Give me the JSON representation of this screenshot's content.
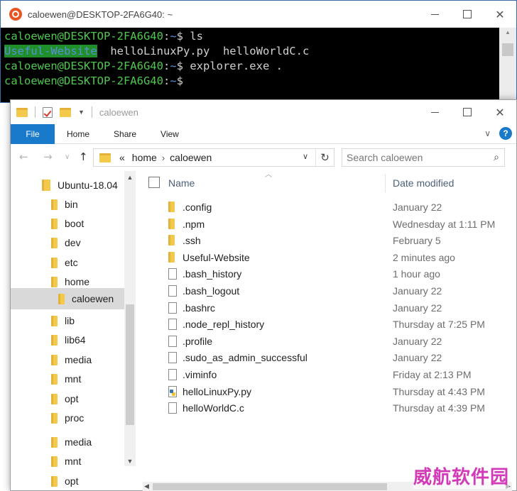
{
  "terminal": {
    "title": "caloewen@DESKTOP-2FA6G40: ~",
    "lines": [
      {
        "user": "caloewen@DESKTOP-2FA6G40",
        "path": "~",
        "cmd": "$ ls"
      },
      {
        "dir": "Useful-Website",
        "files": "  helloLinuxPy.py  helloWorldC.c"
      },
      {
        "user": "caloewen@DESKTOP-2FA6G40",
        "path": "~",
        "cmd": "$ explorer.exe ."
      },
      {
        "user": "caloewen@DESKTOP-2FA6G40",
        "path": "~",
        "cmd": "$"
      }
    ]
  },
  "explorer": {
    "title": "caloewen",
    "ribbon_tabs": [
      "File",
      "Home",
      "Share",
      "View"
    ],
    "help_label": "?",
    "address": {
      "prefix": "«",
      "crumbs": [
        "home",
        "caloewen"
      ]
    },
    "search_placeholder": "Search caloewen",
    "tree": [
      {
        "label": "Ubuntu-18.04",
        "selected": false
      },
      {
        "label": "bin"
      },
      {
        "label": "boot"
      },
      {
        "label": "dev"
      },
      {
        "label": "etc"
      },
      {
        "label": "home"
      },
      {
        "label": "caloewen",
        "selected": true
      },
      {
        "label": "lib"
      },
      {
        "label": "lib64"
      },
      {
        "label": "media"
      },
      {
        "label": "mnt"
      },
      {
        "label": "opt"
      },
      {
        "label": "proc"
      },
      {
        "label": "media"
      },
      {
        "label": "mnt"
      },
      {
        "label": "opt"
      }
    ],
    "columns": {
      "name": "Name",
      "date": "Date modified"
    },
    "files": [
      {
        "name": ".config",
        "date": "January 22",
        "type": "folder"
      },
      {
        "name": ".npm",
        "date": "Wednesday at 1:11 PM",
        "type": "folder"
      },
      {
        "name": ".ssh",
        "date": "February 5",
        "type": "folder"
      },
      {
        "name": "Useful-Website",
        "date": "2 minutes ago",
        "type": "folder"
      },
      {
        "name": ".bash_history",
        "date": "1 hour ago",
        "type": "file"
      },
      {
        "name": ".bash_logout",
        "date": "January 22",
        "type": "file"
      },
      {
        "name": ".bashrc",
        "date": "January 22",
        "type": "file"
      },
      {
        "name": ".node_repl_history",
        "date": "Thursday at 7:25 PM",
        "type": "file"
      },
      {
        "name": ".profile",
        "date": "January 22",
        "type": "file"
      },
      {
        "name": ".sudo_as_admin_successful",
        "date": "January 22",
        "type": "file"
      },
      {
        "name": ".viminfo",
        "date": "Friday at 2:13 PM",
        "type": "file"
      },
      {
        "name": "helloLinuxPy.py",
        "date": "Thursday at 4:43 PM",
        "type": "python"
      },
      {
        "name": "helloWorldC.c",
        "date": "Thursday at 4:39 PM",
        "type": "file"
      }
    ]
  },
  "watermark": "威航软件园",
  "colors": {
    "accent": "#1979ca",
    "terminal_user": "#4ec94e",
    "terminal_path": "#5b8fd9",
    "folder": "#f3c94c"
  }
}
